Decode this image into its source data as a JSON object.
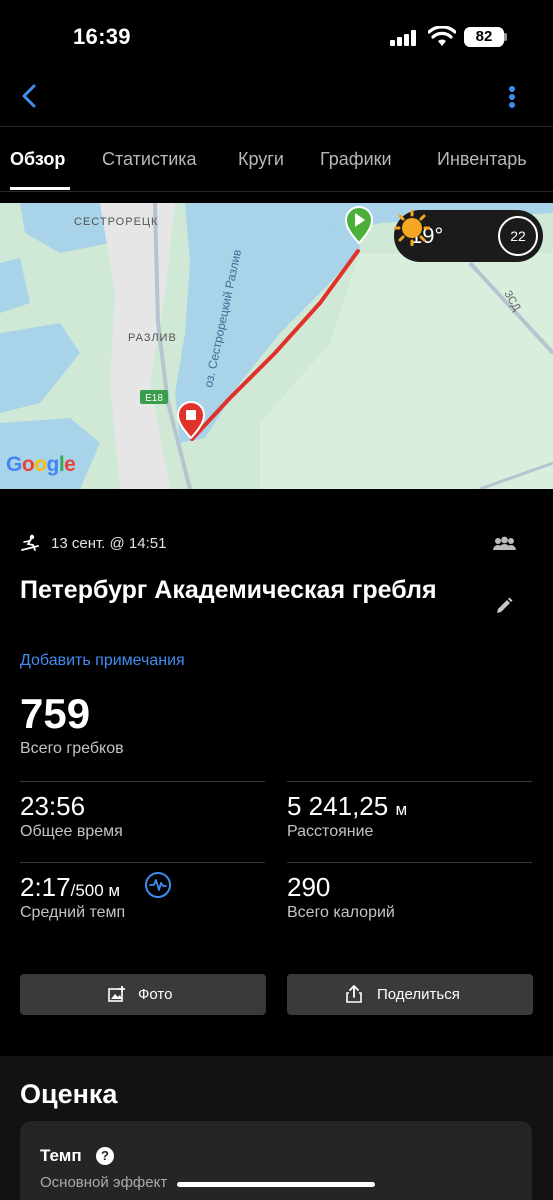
{
  "status_bar": {
    "time": "16:39",
    "battery": "82"
  },
  "tabs": [
    {
      "label": "Обзор",
      "active": true
    },
    {
      "label": "Статистика",
      "active": false
    },
    {
      "label": "Круги",
      "active": false
    },
    {
      "label": "Графики",
      "active": false
    },
    {
      "label": "Инвентарь",
      "active": false
    }
  ],
  "map": {
    "labels": {
      "town_north": "СЕСТРОРЕЦК",
      "town_south": "РАЗЛИВ",
      "lake": "оз. Сестрорецкий Разлив",
      "road": "E18",
      "road_east": "ЗСД"
    },
    "google": "Google",
    "weather": {
      "temperature": "19°",
      "wind_speed": "22"
    },
    "colors": {
      "water": "#a9d3e8",
      "land": "#cfe9d6",
      "route": "#e0312b",
      "start": "#4caf3a",
      "finish": "#e0312b"
    }
  },
  "activity": {
    "date": "13 сент. @ 14:51",
    "title": "Петербург Академическая гребля",
    "add_notes": "Добавить примечания",
    "total_strokes": {
      "value": "759",
      "label": "Всего гребков"
    },
    "stats": {
      "total_time": {
        "value": "23:56",
        "label": "Общее время"
      },
      "distance": {
        "value": "5 241,25",
        "unit": "м",
        "label": "Расстояние"
      },
      "avg_pace": {
        "value": "2:17",
        "unit": "/500 м",
        "label": "Средний темп"
      },
      "calories": {
        "value": "290",
        "label": "Всего калорий"
      }
    },
    "buttons": {
      "photo": "Фото",
      "share": "Поделиться"
    }
  },
  "rating": {
    "title": "Оценка",
    "card_title": "Темп",
    "card_subtitle": "Основной эффект"
  },
  "accent_color": "#3f8cf0"
}
